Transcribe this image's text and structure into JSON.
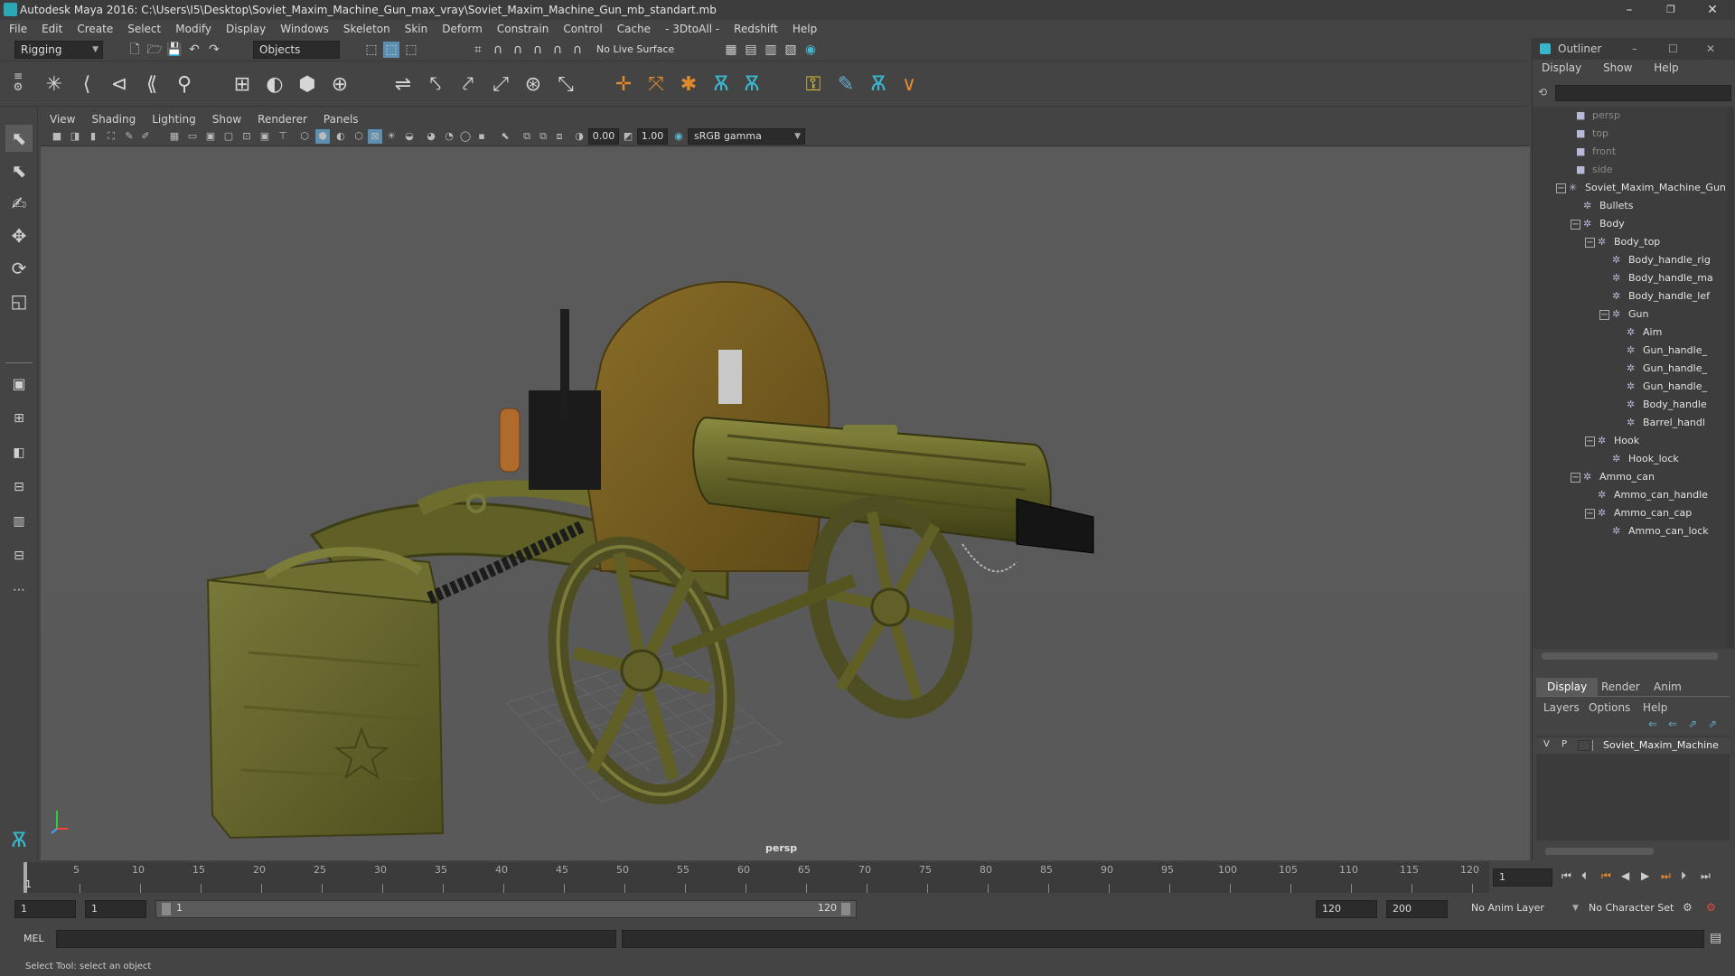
{
  "window": {
    "title": "Autodesk Maya 2016: C:\\Users\\I5\\Desktop\\Soviet_Maxim_Machine_Gun_max_vray\\Soviet_Maxim_Machine_Gun_mb_standart.mb",
    "minimize": "–",
    "maximize": "❐",
    "close": "✕"
  },
  "menubar": [
    "File",
    "Edit",
    "Create",
    "Select",
    "Modify",
    "Display",
    "Windows",
    "Skeleton",
    "Skin",
    "Deform",
    "Constrain",
    "Control",
    "Cache",
    "- 3DtoAll -",
    "Redshift",
    "Help"
  ],
  "statusline": {
    "mode": "Rigging",
    "select_mode": "Objects",
    "live_surface": "No Live Surface"
  },
  "viewport": {
    "menus": [
      "View",
      "Shading",
      "Lighting",
      "Show",
      "Renderer",
      "Panels"
    ],
    "exposure": "0.00",
    "gamma": "1.00",
    "color_space": "sRGB gamma",
    "camera": "persp",
    "colors": {
      "bg": "#5a5a5a",
      "olive": "#6b6b2c",
      "olive_dark": "#4a4a1e",
      "brown": "#7c6222",
      "black": "#1b1b1b"
    }
  },
  "outliner": {
    "title": "Outliner",
    "menus": [
      "Display",
      "Show",
      "Help"
    ],
    "cameras": [
      "persp",
      "top",
      "front",
      "side"
    ],
    "tree": [
      {
        "label": "Soviet_Maxim_Machine_Gun",
        "depth": 0,
        "expanded": true
      },
      {
        "label": "Bullets",
        "depth": 1
      },
      {
        "label": "Body",
        "depth": 1,
        "expanded": true
      },
      {
        "label": "Body_top",
        "depth": 2,
        "expanded": true
      },
      {
        "label": "Body_handle_rig",
        "depth": 3
      },
      {
        "label": "Body_handle_ma",
        "depth": 3
      },
      {
        "label": "Body_handle_lef",
        "depth": 3
      },
      {
        "label": "Gun",
        "depth": 3,
        "expanded": true
      },
      {
        "label": "Aim",
        "depth": 4
      },
      {
        "label": "Gun_handle_",
        "depth": 4
      },
      {
        "label": "Gun_handle_",
        "depth": 4
      },
      {
        "label": "Gun_handle_",
        "depth": 4
      },
      {
        "label": "Body_handle",
        "depth": 4
      },
      {
        "label": "Barrel_handl",
        "depth": 4
      },
      {
        "label": "Hook",
        "depth": 2,
        "expanded": true
      },
      {
        "label": "Hook_lock",
        "depth": 3
      },
      {
        "label": "Ammo_can",
        "depth": 1,
        "expanded": true
      },
      {
        "label": "Ammo_can_handle",
        "depth": 2
      },
      {
        "label": "Ammo_can_cap",
        "depth": 2,
        "expanded": true
      },
      {
        "label": "Ammo_can_lock",
        "depth": 3
      }
    ]
  },
  "layers": {
    "tabs": [
      "Display",
      "Render",
      "Anim"
    ],
    "menus": [
      "Layers",
      "Options",
      "Help"
    ],
    "layer": {
      "v": "V",
      "p": "P",
      "name": "Soviet_Maxim_Machine"
    }
  },
  "timeline": {
    "labels": [
      "1",
      "5",
      "10",
      "15",
      "20",
      "25",
      "30",
      "35",
      "40",
      "45",
      "50",
      "55",
      "60",
      "65",
      "70",
      "75",
      "80",
      "85",
      "90",
      "95",
      "100",
      "105",
      "110",
      "115",
      "120"
    ],
    "current_frame": "1"
  },
  "range": {
    "start": "1",
    "anim_start": "1",
    "slider_start": "1",
    "slider_end": "120",
    "playback_end": "120",
    "anim_end": "200",
    "anim_layer": "No Anim Layer",
    "character_set": "No Character Set"
  },
  "cmdline": {
    "lang": "MEL"
  },
  "helpline": "Select Tool: select an object"
}
